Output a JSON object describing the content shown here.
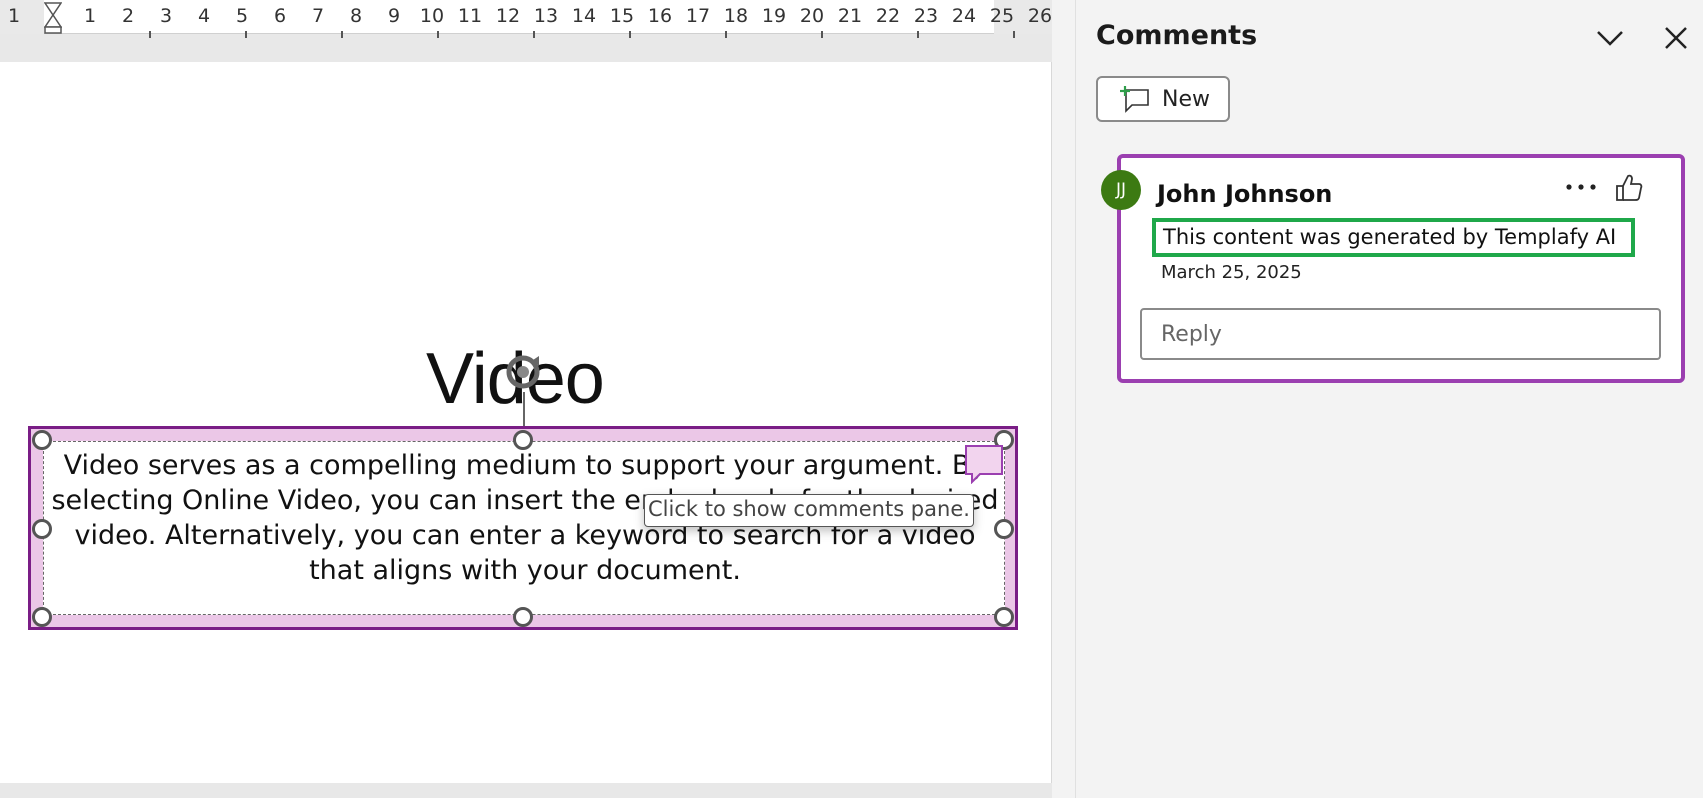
{
  "ruler": {
    "numbers": [
      "1",
      "1",
      "2",
      "3",
      "4",
      "5",
      "6",
      "7",
      "8",
      "9",
      "10",
      "11",
      "12",
      "13",
      "14",
      "15",
      "16",
      "17",
      "18",
      "19",
      "20",
      "21",
      "22",
      "23",
      "24",
      "25",
      "26"
    ]
  },
  "document": {
    "title": "Video",
    "body": "Video serves as a compelling medium to support your argument. By selecting Online Video, you can insert the embed code for the desired video. Alternatively, you can enter a keyword to search for a video that aligns with your document.",
    "tooltip": "Click to show comments pane."
  },
  "pane": {
    "title": "Comments",
    "new_label": "New"
  },
  "comment": {
    "avatar_initials": "JJ",
    "author": "John Johnson",
    "text": "This content was generated by Templafy AI",
    "date": "March 25, 2025",
    "reply_placeholder": "Reply"
  },
  "colors": {
    "selection_border": "#7a1d86",
    "selection_fill": "#ebc7e7",
    "card_border": "#9b3fb0",
    "highlight_border": "#1fa84a",
    "avatar_bg": "#3c7a12"
  }
}
